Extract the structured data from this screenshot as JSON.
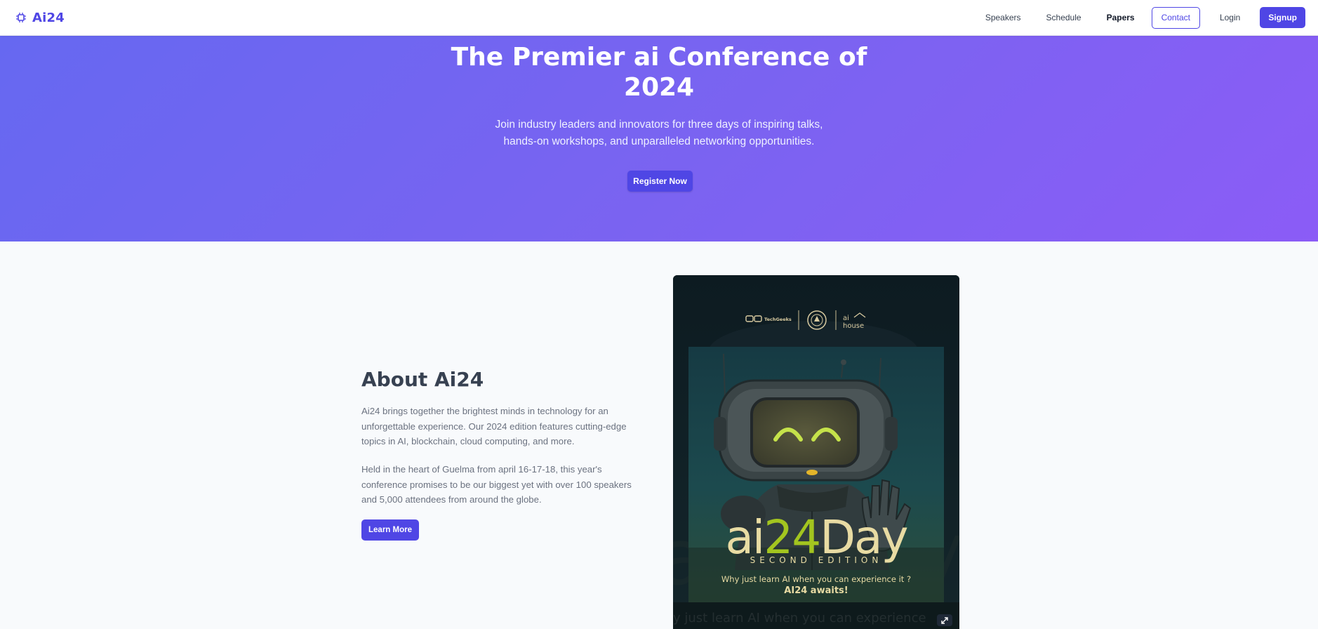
{
  "nav": {
    "brand": "Ai24",
    "links": {
      "speakers": "Speakers",
      "schedule": "Schedule",
      "papers": "Papers",
      "contact": "Contact",
      "login": "Login",
      "signup": "Signup"
    }
  },
  "hero": {
    "title_line1": "The Premier ai Conference of",
    "title_line2": "2024",
    "subtitle_line1": "Join industry leaders and innovators for three days of inspiring talks,",
    "subtitle_line2": "hands-on workshops, and unparalleled networking opportunities.",
    "cta": "Register Now"
  },
  "about": {
    "title": "About Ai24",
    "p1_line1": "Ai24 brings together the brightest minds in technology for an",
    "p1_line2": "unforgettable experience. Our 2024 edition features cutting-edge",
    "p1_line3": "topics in AI, blockchain, cloud computing, and more.",
    "p2_line1": "Held in the heart of Guelma from april 16-17-18, this year's",
    "p2_line2": "conference promises to be our biggest yet with over 100 speakers",
    "p2_line3": "and 5,000 attendees from around the globe.",
    "cta": "Learn More"
  },
  "poster": {
    "sponsor1": "TechGeeks",
    "sponsor3_line1": "ai",
    "sponsor3_line2": "house",
    "wordmark_ai": "ai",
    "wordmark_24": "24",
    "wordmark_day": "Day",
    "edition": "SECOND EDITION",
    "tagline": "Why just learn AI when you can experience it ?",
    "awaits": "AI24 awaits!"
  },
  "colors": {
    "accent": "#4f46e5",
    "hero_start": "#6668f1",
    "hero_end": "#8b5cf6",
    "poster_lime": "#a3c51f",
    "poster_cream": "#e8dba3"
  },
  "icons": {
    "brand": "chip-icon",
    "expand": "expand-icon"
  }
}
